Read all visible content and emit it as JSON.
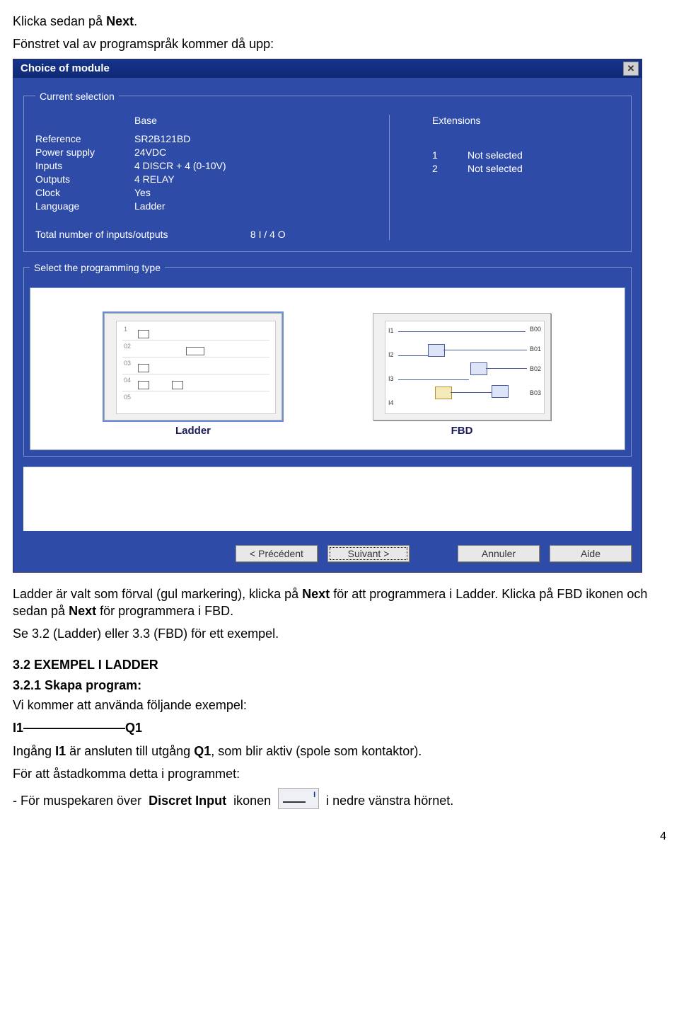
{
  "intro": {
    "line1a": "Klicka sedan på ",
    "line1b": "Next",
    "line1c": ".",
    "line2": "Fönstret val av programspråk kommer då upp:"
  },
  "dialog": {
    "title": "Choice of module",
    "currentSelection": {
      "legend": "Current selection",
      "baseHeader": "Base",
      "extHeader": "Extensions",
      "rows": [
        {
          "label": "Reference",
          "value": "SR2B121BD"
        },
        {
          "label": "Power supply",
          "value": "24VDC"
        },
        {
          "label": "Inputs",
          "value": "4 DISCR + 4 (0-10V)"
        },
        {
          "label": "Outputs",
          "value": "4 RELAY"
        },
        {
          "label": "Clock",
          "value": "Yes"
        },
        {
          "label": "Language",
          "value": "Ladder"
        }
      ],
      "extensions": [
        {
          "num": "1",
          "value": "Not selected"
        },
        {
          "num": "2",
          "value": "Not selected"
        }
      ],
      "totalsLabel": "Total number of inputs/outputs",
      "totalsValue": "8 I / 4 O"
    },
    "progType": {
      "legend": "Select the programming type",
      "ladder": "Ladder",
      "fbd": "FBD"
    },
    "buttons": {
      "prev": "< Précédent",
      "next": "Suivant >",
      "cancel": "Annuler",
      "help": "Aide"
    }
  },
  "after": {
    "p1a": "Ladder är valt som förval (gul markering), klicka på ",
    "p1b": "Next",
    "p1c": " för att programmera i Ladder. Klicka på FBD ikonen och sedan på ",
    "p1d": "Next",
    "p1e": " för programmera i FBD.",
    "p2": "Se 3.2 (Ladder) eller 3.3 (FBD) för ett exempel.",
    "h1": "3.2 EXEMPEL I LADDER",
    "h2": "3.2.1 Skapa program:",
    "p3": "Vi kommer att använda följande exempel:",
    "io": "I1————————Q1",
    "p4a": "Ingång ",
    "p4b": "I1",
    "p4c": " är ansluten till utgång ",
    "p4d": "Q1",
    "p4e": ", som blir aktiv (spole som kontaktor).",
    "p5": "För att åstadkomma detta i programmet:",
    "p6a": "- För muspekaren över ",
    "p6b": "Discret Input",
    "p6c": " ikonen ",
    "p6d": " i nedre vänstra hörnet."
  },
  "pagenum": "4"
}
